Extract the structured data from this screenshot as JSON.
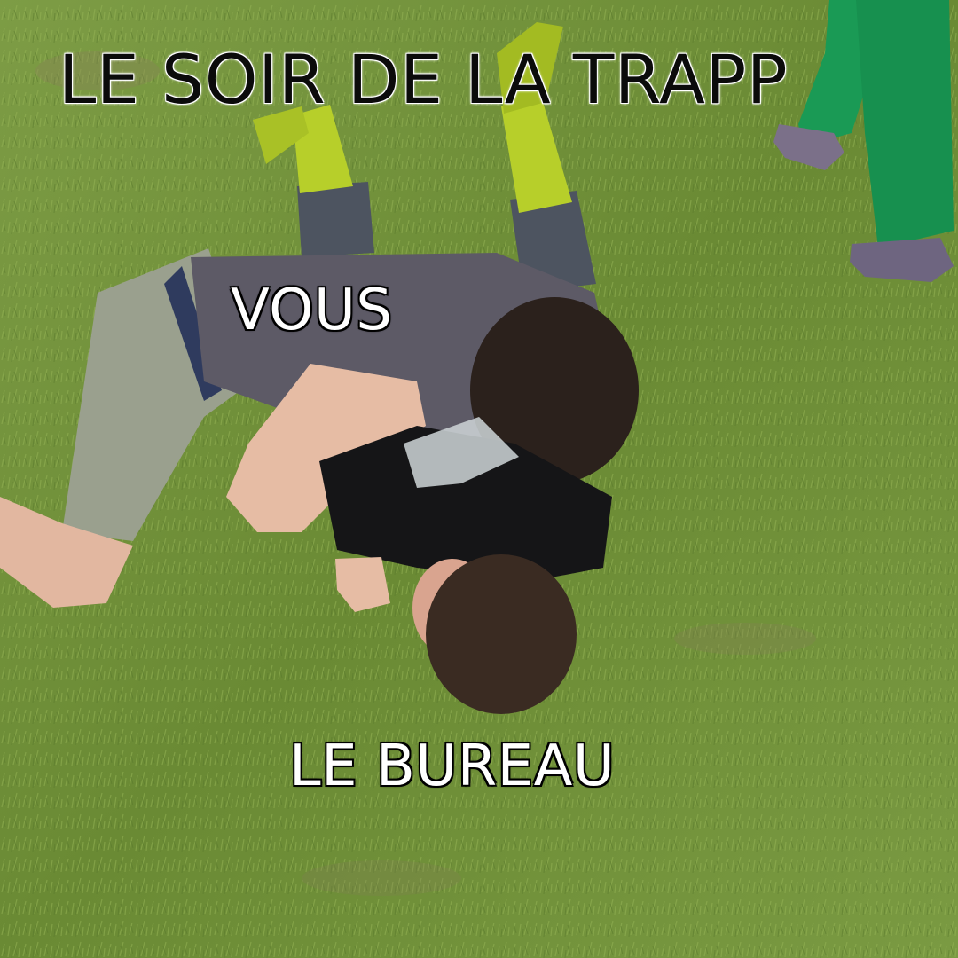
{
  "meme": {
    "top_caption": "LE SOIR DE LA TRAPP",
    "label_you": "VOUS",
    "label_office": "LE BUREAU"
  },
  "colors": {
    "grass": "#6f8f3a",
    "grass_light": "#8fae4e",
    "boots": "#b7cf2a",
    "gray_shirt": "#5d5a66",
    "black_shirt": "#151517",
    "shorts": "#9aa08e",
    "hair": "#2b211c",
    "skin": "#e2b7a0",
    "green_pants": "#1a9a55",
    "dark_text": "#0b0b0b",
    "light_text": "#ffffff"
  }
}
